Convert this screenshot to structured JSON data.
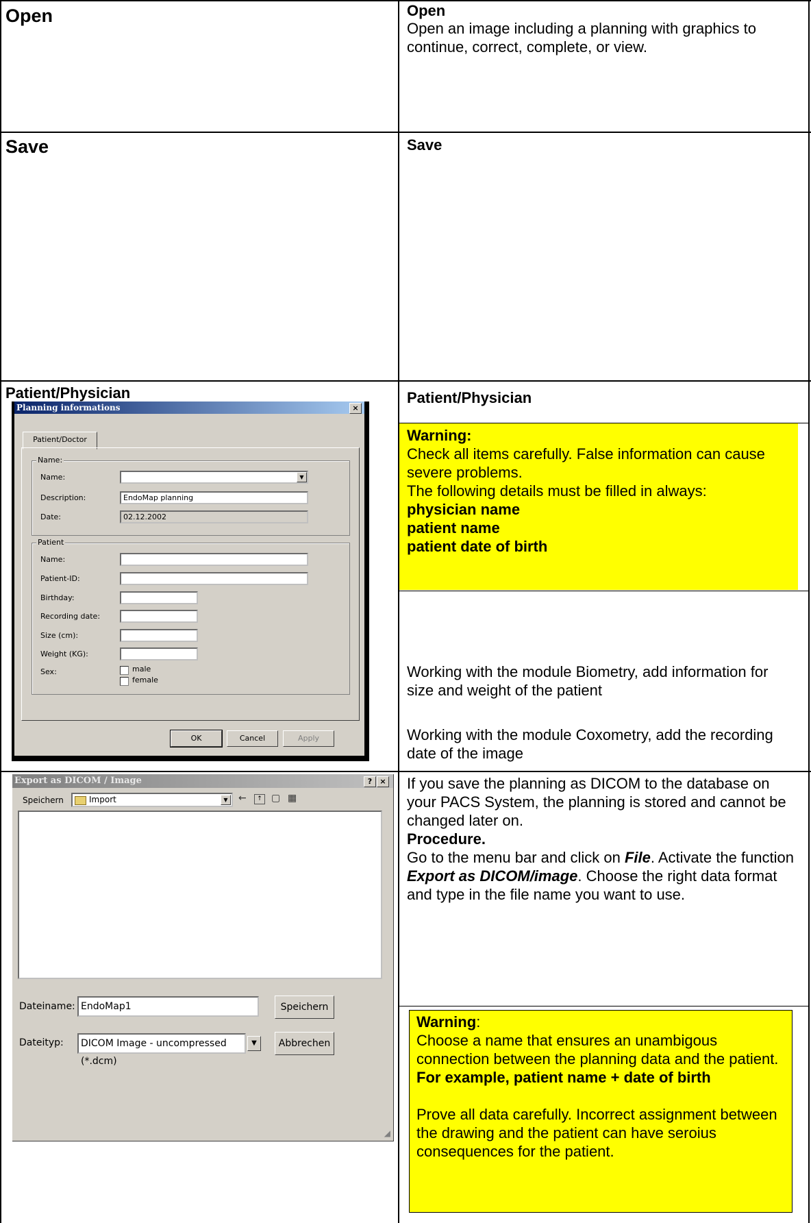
{
  "row1": {
    "left_heading": "Open",
    "right_heading": "Open",
    "right_text": "Open an image including a planning with graphics to continue, correct, complete, or view."
  },
  "row2": {
    "left_heading": "Save",
    "right_heading": "Save"
  },
  "row3": {
    "left_heading": "Patient/Physician",
    "right_heading": "Patient/Physician",
    "warning_title": "Warning:",
    "warning_text1": "Check all items carefully. False information can cause severe problems.",
    "warning_text2": "The following details must be filled in always:",
    "warning_items": [
      "physician name",
      "patient name",
      "patient date of birth"
    ],
    "info1": "Working with the module Biometry, add information for size and weight of the patient",
    "info2": "Working with the module Coxometry, add the recording date of the image"
  },
  "planning_dialog": {
    "title": "Planning informations",
    "close": "×",
    "tab": "Patient/Doctor",
    "group_name": "Name:",
    "name_label": "Name:",
    "name_value": "",
    "description_label": "Description:",
    "description_value": "EndoMap planning",
    "date_label": "Date:",
    "date_value": "02.12.2002",
    "group_patient": "Patient",
    "patient_fields": [
      "Name:",
      "Patient-ID:",
      "Birthday:",
      "Recording date:",
      "Size (cm):",
      "Weight (KG):",
      "Sex:"
    ],
    "sex_options": [
      "male",
      "female"
    ],
    "ok": "OK",
    "cancel": "Cancel",
    "apply": "Apply"
  },
  "export_dialog": {
    "title": "Export as DICOM / Image",
    "help": "?",
    "close": "×",
    "save_in_label": "Speichern",
    "save_in_value": "Import",
    "filename_label": "Dateiname:",
    "filename_value": "EndoMap1",
    "filetype_label": "Dateityp:",
    "filetype_value": "DICOM Image - uncompressed (*.dcm)",
    "save_button": "Speichern",
    "cancel_button": "Abbrechen"
  },
  "row4": {
    "text1": "If you save the planning as DICOM to the database on your PACS System, the planning is stored and cannot be changed later on.",
    "procedure": "Procedure.",
    "text2a": "Go to the menu bar and click on ",
    "text2b": "File",
    "text2c": ". Activate the function ",
    "text2d": "Export as DICOM/image",
    "text2e": ". Choose the right data format and type in the file name you want to use.",
    "warning_title": "Warning",
    "warning_colon": ":",
    "warning_text": "Choose a name that ensures an unambigous connection between the planning data and the patient.",
    "warning_example": "For example, patient name + date of birth",
    "warning_text2": "Prove all data carefully. Incorrect assignment between the drawing and the patient can have seroius consequences for the patient."
  }
}
